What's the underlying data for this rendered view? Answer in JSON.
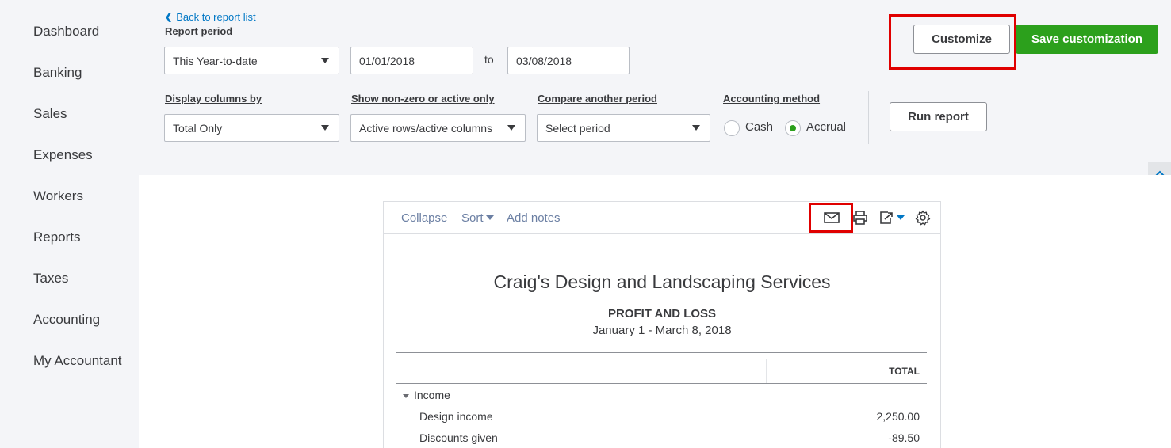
{
  "sidebar": {
    "items": [
      {
        "label": "Dashboard"
      },
      {
        "label": "Banking"
      },
      {
        "label": "Sales"
      },
      {
        "label": "Expenses"
      },
      {
        "label": "Workers"
      },
      {
        "label": "Reports"
      },
      {
        "label": "Taxes"
      },
      {
        "label": "Accounting"
      },
      {
        "label": "My Accountant"
      }
    ]
  },
  "filters": {
    "back_link": "Back to report list",
    "report_period_label": "Report period",
    "report_period_value": "This Year-to-date",
    "date_from": "01/01/2018",
    "to_label": "to",
    "date_to": "03/08/2018",
    "display_columns_label": "Display columns by",
    "display_columns_value": "Total Only",
    "nonzero_label": "Show non-zero or active only",
    "nonzero_value": "Active rows/active columns",
    "compare_label": "Compare another period",
    "compare_value": "Select period",
    "accounting_method_label": "Accounting method",
    "method_cash": "Cash",
    "method_accrual": "Accrual",
    "method_selected": "Accrual"
  },
  "actions": {
    "customize": "Customize",
    "save_customization": "Save customization",
    "run_report": "Run report"
  },
  "toolbar": {
    "collapse": "Collapse",
    "sort": "Sort",
    "add_notes": "Add notes"
  },
  "report": {
    "company": "Craig's Design and Landscaping Services",
    "title": "PROFIT AND LOSS",
    "date_range": "January 1 - March 8, 2018",
    "column_header": "TOTAL",
    "section": "Income",
    "rows": [
      {
        "label": "Design income",
        "value": "2,250.00"
      },
      {
        "label": "Discounts given",
        "value": "-89.50"
      }
    ]
  },
  "colors": {
    "primary_green": "#2ca01c",
    "link_blue": "#0077c5",
    "highlight_red": "#e00000"
  }
}
